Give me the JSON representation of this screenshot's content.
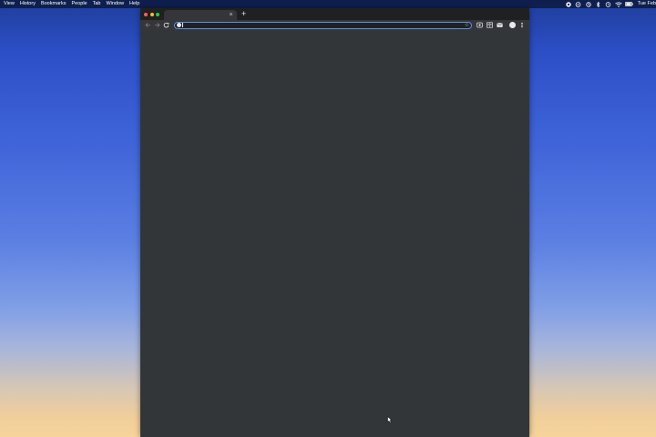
{
  "menubar": {
    "menus": [
      "View",
      "History",
      "Bookmarks",
      "People",
      "Tab",
      "Window",
      "Help"
    ],
    "status_icons": [
      "record-icon",
      "cloud-icon",
      "sync-icon",
      "bluetooth-icon",
      "time-machine-icon",
      "wifi-icon",
      "battery-icon"
    ],
    "clock": "Tue Feb"
  },
  "browser": {
    "tab": {
      "title": "",
      "close_glyph": "×"
    },
    "new_tab_glyph": "+",
    "toolbar": {
      "back_icon": "arrow-left-icon",
      "forward_icon": "arrow-right-icon",
      "reload_icon": "reload-icon",
      "omnibox_value": "",
      "bookmark_glyph": "☆",
      "extensions": [
        "shield-extension-icon",
        "reader-extension-icon",
        "mail-extension-icon"
      ],
      "profile_icon": "profile-avatar-icon",
      "menu_icon": "more-vertical-icon"
    },
    "colors": {
      "window_bg": "#323639",
      "tabstrip_bg": "#1f2022",
      "toolbar_bg": "#35363a",
      "omnibox_bg": "#202124",
      "focus_ring": "#5f8fe0"
    }
  }
}
